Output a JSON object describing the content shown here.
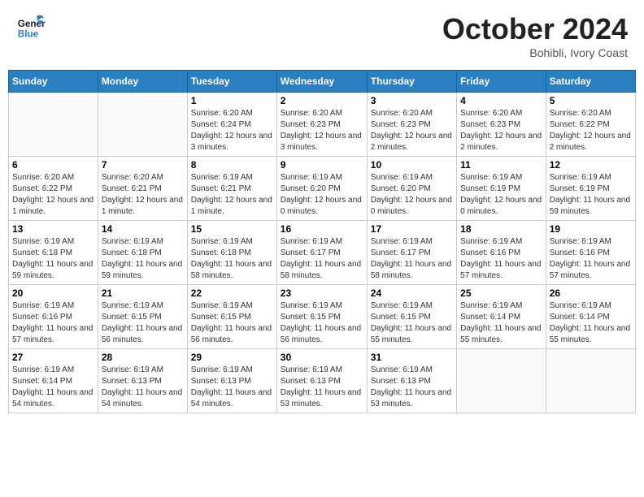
{
  "header": {
    "logo_general": "General",
    "logo_blue": "Blue",
    "month": "October 2024",
    "location": "Bohibli, Ivory Coast"
  },
  "weekdays": [
    "Sunday",
    "Monday",
    "Tuesday",
    "Wednesday",
    "Thursday",
    "Friday",
    "Saturday"
  ],
  "weeks": [
    [
      {
        "day": "",
        "info": ""
      },
      {
        "day": "",
        "info": ""
      },
      {
        "day": "1",
        "info": "Sunrise: 6:20 AM\nSunset: 6:24 PM\nDaylight: 12 hours and 3 minutes."
      },
      {
        "day": "2",
        "info": "Sunrise: 6:20 AM\nSunset: 6:23 PM\nDaylight: 12 hours and 3 minutes."
      },
      {
        "day": "3",
        "info": "Sunrise: 6:20 AM\nSunset: 6:23 PM\nDaylight: 12 hours and 2 minutes."
      },
      {
        "day": "4",
        "info": "Sunrise: 6:20 AM\nSunset: 6:23 PM\nDaylight: 12 hours and 2 minutes."
      },
      {
        "day": "5",
        "info": "Sunrise: 6:20 AM\nSunset: 6:22 PM\nDaylight: 12 hours and 2 minutes."
      }
    ],
    [
      {
        "day": "6",
        "info": "Sunrise: 6:20 AM\nSunset: 6:22 PM\nDaylight: 12 hours and 1 minute."
      },
      {
        "day": "7",
        "info": "Sunrise: 6:20 AM\nSunset: 6:21 PM\nDaylight: 12 hours and 1 minute."
      },
      {
        "day": "8",
        "info": "Sunrise: 6:19 AM\nSunset: 6:21 PM\nDaylight: 12 hours and 1 minute."
      },
      {
        "day": "9",
        "info": "Sunrise: 6:19 AM\nSunset: 6:20 PM\nDaylight: 12 hours and 0 minutes."
      },
      {
        "day": "10",
        "info": "Sunrise: 6:19 AM\nSunset: 6:20 PM\nDaylight: 12 hours and 0 minutes."
      },
      {
        "day": "11",
        "info": "Sunrise: 6:19 AM\nSunset: 6:19 PM\nDaylight: 12 hours and 0 minutes."
      },
      {
        "day": "12",
        "info": "Sunrise: 6:19 AM\nSunset: 6:19 PM\nDaylight: 11 hours and 59 minutes."
      }
    ],
    [
      {
        "day": "13",
        "info": "Sunrise: 6:19 AM\nSunset: 6:18 PM\nDaylight: 11 hours and 59 minutes."
      },
      {
        "day": "14",
        "info": "Sunrise: 6:19 AM\nSunset: 6:18 PM\nDaylight: 11 hours and 59 minutes."
      },
      {
        "day": "15",
        "info": "Sunrise: 6:19 AM\nSunset: 6:18 PM\nDaylight: 11 hours and 58 minutes."
      },
      {
        "day": "16",
        "info": "Sunrise: 6:19 AM\nSunset: 6:17 PM\nDaylight: 11 hours and 58 minutes."
      },
      {
        "day": "17",
        "info": "Sunrise: 6:19 AM\nSunset: 6:17 PM\nDaylight: 11 hours and 58 minutes."
      },
      {
        "day": "18",
        "info": "Sunrise: 6:19 AM\nSunset: 6:16 PM\nDaylight: 11 hours and 57 minutes."
      },
      {
        "day": "19",
        "info": "Sunrise: 6:19 AM\nSunset: 6:16 PM\nDaylight: 11 hours and 57 minutes."
      }
    ],
    [
      {
        "day": "20",
        "info": "Sunrise: 6:19 AM\nSunset: 6:16 PM\nDaylight: 11 hours and 57 minutes."
      },
      {
        "day": "21",
        "info": "Sunrise: 6:19 AM\nSunset: 6:15 PM\nDaylight: 11 hours and 56 minutes."
      },
      {
        "day": "22",
        "info": "Sunrise: 6:19 AM\nSunset: 6:15 PM\nDaylight: 11 hours and 56 minutes."
      },
      {
        "day": "23",
        "info": "Sunrise: 6:19 AM\nSunset: 6:15 PM\nDaylight: 11 hours and 56 minutes."
      },
      {
        "day": "24",
        "info": "Sunrise: 6:19 AM\nSunset: 6:15 PM\nDaylight: 11 hours and 55 minutes."
      },
      {
        "day": "25",
        "info": "Sunrise: 6:19 AM\nSunset: 6:14 PM\nDaylight: 11 hours and 55 minutes."
      },
      {
        "day": "26",
        "info": "Sunrise: 6:19 AM\nSunset: 6:14 PM\nDaylight: 11 hours and 55 minutes."
      }
    ],
    [
      {
        "day": "27",
        "info": "Sunrise: 6:19 AM\nSunset: 6:14 PM\nDaylight: 11 hours and 54 minutes."
      },
      {
        "day": "28",
        "info": "Sunrise: 6:19 AM\nSunset: 6:13 PM\nDaylight: 11 hours and 54 minutes."
      },
      {
        "day": "29",
        "info": "Sunrise: 6:19 AM\nSunset: 6:13 PM\nDaylight: 11 hours and 54 minutes."
      },
      {
        "day": "30",
        "info": "Sunrise: 6:19 AM\nSunset: 6:13 PM\nDaylight: 11 hours and 53 minutes."
      },
      {
        "day": "31",
        "info": "Sunrise: 6:19 AM\nSunset: 6:13 PM\nDaylight: 11 hours and 53 minutes."
      },
      {
        "day": "",
        "info": ""
      },
      {
        "day": "",
        "info": ""
      }
    ]
  ]
}
